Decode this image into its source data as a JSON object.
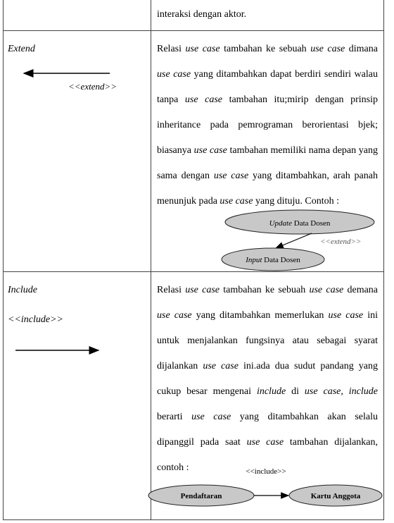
{
  "rows": [
    {
      "label": "",
      "desc": [
        {
          "t": "interaksi dengan aktor."
        }
      ]
    },
    {
      "label": "Extend",
      "notation": "<<extend>>",
      "desc": [
        {
          "t": "Relasi "
        },
        {
          "t": "use case",
          "i": 1
        },
        {
          "t": " tambahan ke sebuah "
        },
        {
          "t": "use case",
          "i": 1
        },
        {
          "t": " dimana "
        },
        {
          "t": "use case",
          "i": 1
        },
        {
          "t": " yang ditambahkan dapat berdiri sendiri walau tanpa "
        },
        {
          "t": "use case",
          "i": 1
        },
        {
          "t": " tambahan itu;mirip dengan prinsip inheritance pada pemrograman berorientasi bjek; biasanya "
        },
        {
          "t": "use case",
          "i": 1
        },
        {
          "t": " tambahan memiliki nama depan yang sama dengan "
        },
        {
          "t": "use case",
          "i": 1
        },
        {
          "t": " yang ditambahkan, arah panah menunjuk pada "
        },
        {
          "t": "use case",
          "i": 1
        },
        {
          "t": " yang dituju. Contoh :"
        }
      ],
      "example": {
        "from_i": "Update",
        "from": " Data Dosen",
        "to_i": "Input",
        "to": " Data Dosen",
        "stereotype": "<<extend>>"
      }
    },
    {
      "label": "Include",
      "notation": "<<include>>",
      "desc": [
        {
          "t": "Relasi "
        },
        {
          "t": "use case",
          "i": 1
        },
        {
          "t": " tambahan ke sebuah "
        },
        {
          "t": "use case",
          "i": 1
        },
        {
          "t": " demana "
        },
        {
          "t": "use case",
          "i": 1
        },
        {
          "t": " yang ditambahkan memerlukan "
        },
        {
          "t": "use case",
          "i": 1
        },
        {
          "t": " ini untuk menjalankan fungsinya atau sebagai syarat dijalankan "
        },
        {
          "t": "use case",
          "i": 1
        },
        {
          "t": " ini.ada dua sudut pandang yang cukup besar mengenai "
        },
        {
          "t": "include",
          "i": 1
        },
        {
          "t": " di "
        },
        {
          "t": "use case, include",
          "i": 1
        },
        {
          "t": " berarti "
        },
        {
          "t": "use case",
          "i": 1
        },
        {
          "t": " yang ditambahkan akan selalu dipanggil pada saat "
        },
        {
          "t": "use case",
          "i": 1
        },
        {
          "t": " tambahan dijalankan, contoh :"
        }
      ],
      "example": {
        "from": "Pendaftaran",
        "to": "Kartu Anggota",
        "stereotype": "<<include>>"
      }
    }
  ],
  "colors": {
    "ellipse_fill": "#c8c8c8",
    "border": "#444444"
  }
}
